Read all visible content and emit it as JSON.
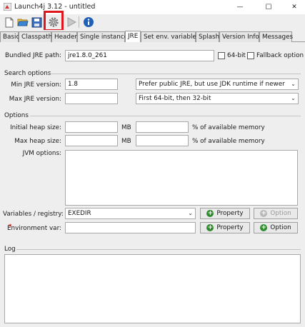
{
  "window": {
    "title": "Launch4j 3.12 - untitled",
    "controls": {
      "minimize": "—",
      "maximize": "☐",
      "close": "✕"
    }
  },
  "toolbar": {
    "buttons": [
      "new-icon",
      "open-icon",
      "save-icon",
      "gear-icon",
      "run-icon",
      "info-icon"
    ]
  },
  "tabs": [
    "Basic",
    "Classpath",
    "Header",
    "Single instance",
    "JRE",
    "Set env. variables",
    "Splash",
    "Version Info",
    "Messages"
  ],
  "active_tab": "JRE",
  "jre": {
    "bundled_label": "Bundled JRE path:",
    "bundled_value": "jre1.8.0_261",
    "bit64_label": "64-bit",
    "fallback_label": "Fallback option"
  },
  "search": {
    "section_label": "Search options",
    "min_label": "Min JRE version:",
    "min_value": "1.8",
    "max_label": "Max JRE version:",
    "max_value": "",
    "jdk_pref": "Prefer public JRE, but use JDK runtime if newer",
    "bitness_pref": "First 64-bit, then 32-bit"
  },
  "options": {
    "section_label": "Options",
    "initial_heap_label": "Initial heap size:",
    "max_heap_label": "Max heap size:",
    "mb": "MB",
    "percent_label": "% of available memory",
    "jvm_label": "JVM options:",
    "vars_label": "Variables / registry:",
    "vars_value": "EXEDIR",
    "env_star": "*",
    "env_label": "Environment var:",
    "property_label": "Property",
    "option_label": "Option"
  },
  "log": {
    "label": "Log"
  },
  "colors": {
    "highlight": "#e0161e",
    "green": "#2e8b2e"
  }
}
